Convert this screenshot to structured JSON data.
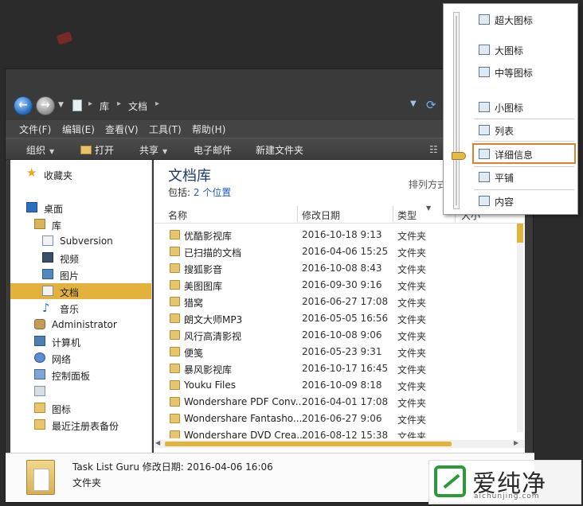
{
  "address": {
    "crumbs": [
      "库",
      "文档"
    ]
  },
  "menubar": {
    "items": [
      "文件(F)",
      "编辑(E)",
      "查看(V)",
      "工具(T)",
      "帮助(H)"
    ]
  },
  "toolbar": {
    "organize": "组织",
    "open": "打开",
    "share": "共享",
    "email": "电子邮件",
    "new_folder": "新建文件夹"
  },
  "navpane": {
    "favorites": "收藏夹",
    "desktop": "桌面",
    "libraries": "库",
    "subversion": "Subversion",
    "videos": "视频",
    "pictures": "图片",
    "documents": "文档",
    "music": "音乐",
    "administrator": "Administrator",
    "computer": "计算机",
    "network": "网络",
    "control_panel": "控制面板",
    "recycle_bin": "",
    "icons": "图标",
    "registry_backup": "最近注册表备份"
  },
  "content": {
    "title": "文档库",
    "includes_label": "包括:",
    "includes_value": "2 个位置",
    "arrange": "排列方式",
    "columns": {
      "name": "名称",
      "date": "修改日期",
      "type": "类型",
      "size": "大小"
    },
    "rows": [
      {
        "name": "优酷影视库",
        "date": "2016-10-18 9:13",
        "type": "文件夹"
      },
      {
        "name": "已扫描的文档",
        "date": "2016-04-06 15:25",
        "type": "文件夹"
      },
      {
        "name": "搜狐影音",
        "date": "2016-10-08 8:43",
        "type": "文件夹"
      },
      {
        "name": "美图图库",
        "date": "2016-09-30 9:16",
        "type": "文件夹"
      },
      {
        "name": "猎窝",
        "date": "2016-06-27 17:08",
        "type": "文件夹"
      },
      {
        "name": "朗文大师MP3",
        "date": "2016-05-05 16:56",
        "type": "文件夹"
      },
      {
        "name": "风行高清影视",
        "date": "2016-10-08 9:06",
        "type": "文件夹"
      },
      {
        "name": "便笺",
        "date": "2016-05-23 9:31",
        "type": "文件夹"
      },
      {
        "name": "暴风影视库",
        "date": "2016-10-17 16:45",
        "type": "文件夹"
      },
      {
        "name": "Youku Files",
        "date": "2016-10-09 8:18",
        "type": "文件夹"
      },
      {
        "name": "Wondershare PDF Conv...",
        "date": "2016-04-01 17:08",
        "type": "文件夹"
      },
      {
        "name": "Wondershare Fantasho...",
        "date": "2016-06-27 9:06",
        "type": "文件夹"
      },
      {
        "name": "Wondershare DVD Crea...",
        "date": "2016-08-12 15:38",
        "type": "文件夹"
      }
    ]
  },
  "details": {
    "name_line": "Task List Guru  修改日期: 2016-04-06 16:06",
    "type": "文件夹"
  },
  "viewmenu": {
    "extra_large": "超大图标",
    "large": "大图标",
    "medium": "中等图标",
    "small": "小图标",
    "list": "列表",
    "details": "详细信息",
    "tiles": "平铺",
    "content": "内容",
    "selected": "详细信息"
  },
  "watermark": {
    "text": "爱纯净",
    "url": "aichunjing.com"
  },
  "colors": {
    "accent": "#e3b23c",
    "highlight_border": "#e07f2b"
  }
}
